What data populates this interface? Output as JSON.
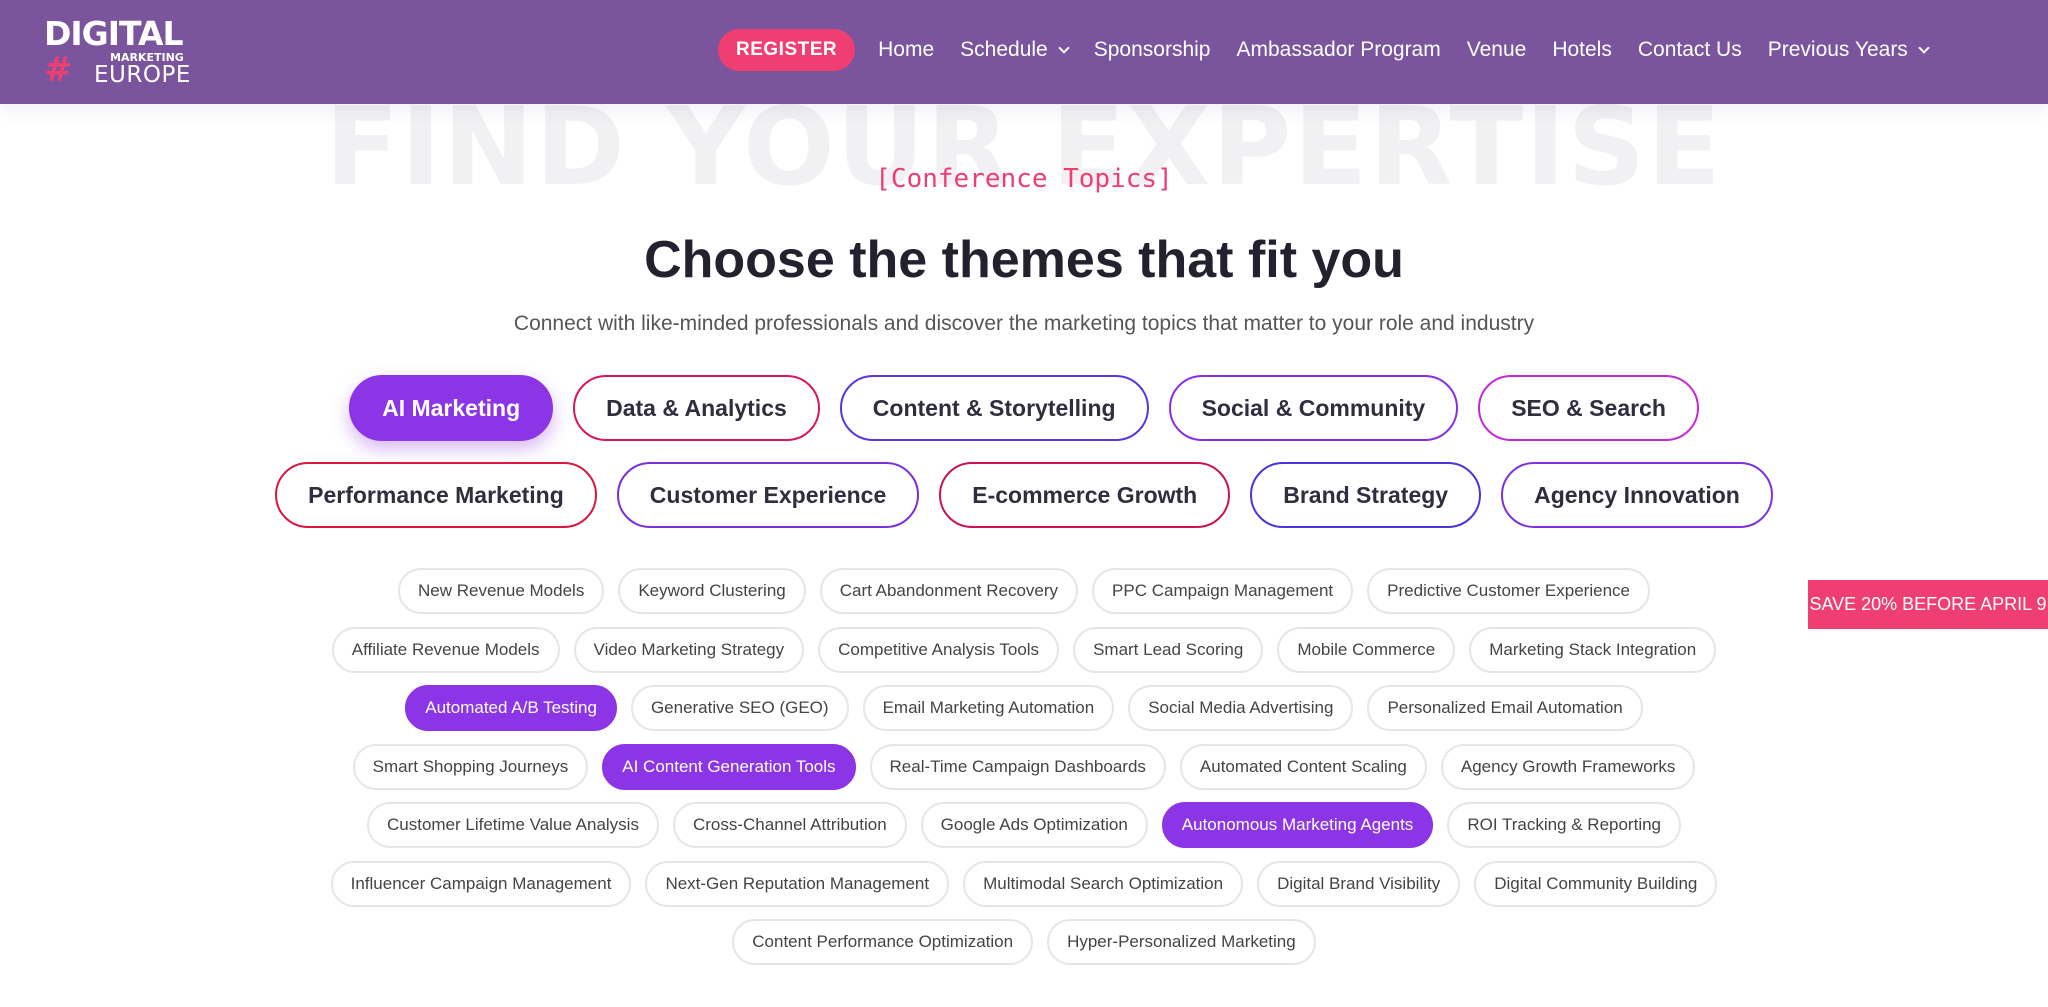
{
  "header": {
    "logo": {
      "line1": "DIGITAL",
      "line2": "MARKETING",
      "line3": "EUROPE",
      "hash": "#"
    },
    "register_label": "REGISTER",
    "nav": [
      {
        "label": "Home",
        "has_dropdown": false
      },
      {
        "label": "Schedule",
        "has_dropdown": true
      },
      {
        "label": "Sponsorship",
        "has_dropdown": false
      },
      {
        "label": "Ambassador Program",
        "has_dropdown": false
      },
      {
        "label": "Venue",
        "has_dropdown": false
      },
      {
        "label": "Hotels",
        "has_dropdown": false
      },
      {
        "label": "Contact Us",
        "has_dropdown": false
      },
      {
        "label": "Previous Years",
        "has_dropdown": true
      }
    ]
  },
  "hero": {
    "background_title": "FIND YOUR EXPERTISE",
    "eyebrow": "[Conference Topics]",
    "headline": "Choose the themes that fit you",
    "subline": "Connect with like-minded professionals and discover the marketing topics that matter to your role and industry"
  },
  "categories": {
    "row1": [
      {
        "label": "AI Marketing",
        "active": true,
        "color": "#8b35e6"
      },
      {
        "label": "Data & Analytics",
        "active": false,
        "color": "#d9185a"
      },
      {
        "label": "Content & Storytelling",
        "active": false,
        "color": "#5b35e0"
      },
      {
        "label": "Social & Community",
        "active": false,
        "color": "#8a2ee0"
      },
      {
        "label": "SEO & Search",
        "active": false,
        "color": "#c42bd6"
      }
    ],
    "row2": [
      {
        "label": "Performance Marketing",
        "active": false,
        "color": "#d91840"
      },
      {
        "label": "Customer Experience",
        "active": false,
        "color": "#7a2fd8"
      },
      {
        "label": "E-commerce Growth",
        "active": false,
        "color": "#c8164c"
      },
      {
        "label": "Brand Strategy",
        "active": false,
        "color": "#4a35d8"
      },
      {
        "label": "Agency Innovation",
        "active": false,
        "color": "#7e30e0"
      }
    ]
  },
  "tags": [
    [
      {
        "label": "New Revenue Models",
        "active": false
      },
      {
        "label": "Keyword Clustering",
        "active": false
      },
      {
        "label": "Cart Abandonment Recovery",
        "active": false
      },
      {
        "label": "PPC Campaign Management",
        "active": false
      },
      {
        "label": "Predictive Customer Experience",
        "active": false
      }
    ],
    [
      {
        "label": "Affiliate Revenue Models",
        "active": false
      },
      {
        "label": "Video Marketing Strategy",
        "active": false
      },
      {
        "label": "Competitive Analysis Tools",
        "active": false
      },
      {
        "label": "Smart Lead Scoring",
        "active": false
      },
      {
        "label": "Mobile Commerce",
        "active": false
      },
      {
        "label": "Marketing Stack Integration",
        "active": false
      }
    ],
    [
      {
        "label": "Automated A/B Testing",
        "active": true
      },
      {
        "label": "Generative SEO (GEO)",
        "active": false
      },
      {
        "label": "Email Marketing Automation",
        "active": false
      },
      {
        "label": "Social Media Advertising",
        "active": false
      },
      {
        "label": "Personalized Email Automation",
        "active": false
      }
    ],
    [
      {
        "label": "Smart Shopping Journeys",
        "active": false
      },
      {
        "label": "AI Content Generation Tools",
        "active": true
      },
      {
        "label": "Real-Time Campaign Dashboards",
        "active": false
      },
      {
        "label": "Automated Content Scaling",
        "active": false
      },
      {
        "label": "Agency Growth Frameworks",
        "active": false
      }
    ],
    [
      {
        "label": "Customer Lifetime Value Analysis",
        "active": false
      },
      {
        "label": "Cross-Channel Attribution",
        "active": false
      },
      {
        "label": "Google Ads Optimization",
        "active": false
      },
      {
        "label": "Autonomous Marketing Agents",
        "active": true
      },
      {
        "label": "ROI Tracking & Reporting",
        "active": false
      }
    ],
    [
      {
        "label": "Influencer Campaign Management",
        "active": false
      },
      {
        "label": "Next-Gen Reputation Management",
        "active": false
      },
      {
        "label": "Multimodal Search Optimization",
        "active": false
      },
      {
        "label": "Digital Brand Visibility",
        "active": false
      },
      {
        "label": "Digital Community Building",
        "active": false
      }
    ],
    [
      {
        "label": "Content Performance Optimization",
        "active": false
      },
      {
        "label": "Hyper-Personalized Marketing",
        "active": false
      }
    ]
  ],
  "promo": {
    "label": "SAVE 20% BEFORE APRIL 9"
  },
  "colors": {
    "header_bg": "#7a549c",
    "accent_pink": "#ef3e72",
    "accent_purple": "#8b35e6"
  }
}
